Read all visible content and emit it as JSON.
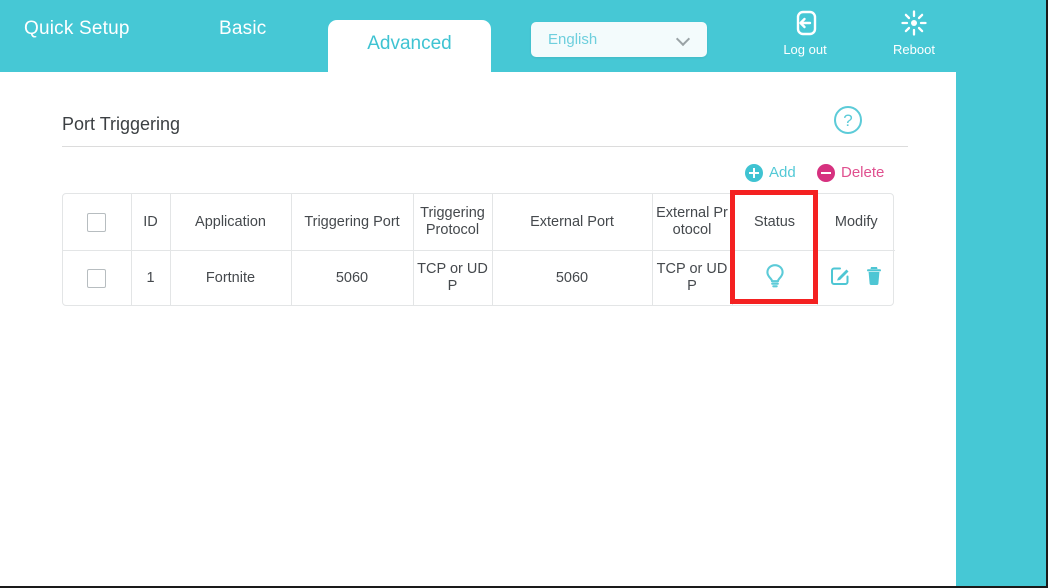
{
  "theme": {
    "teal": "#46c8d5",
    "teal_text": "#3fc3d2",
    "pink": "#d6317f",
    "highlight": "#f42121"
  },
  "header": {
    "tabs": [
      {
        "label": "Quick Setup",
        "active": false
      },
      {
        "label": "Basic",
        "active": false
      },
      {
        "label": "Advanced",
        "active": true
      }
    ],
    "language": {
      "value": "English",
      "icon": "chevron-down-icon"
    },
    "actions": [
      {
        "label": "Log out",
        "icon": "logout-icon"
      },
      {
        "label": "Reboot",
        "icon": "reboot-icon"
      }
    ]
  },
  "page": {
    "title": "Port Triggering",
    "help_icon": "help-circle-icon"
  },
  "toolbar": {
    "add_label": "Add",
    "delete_label": "Delete",
    "add_icon": "plus-circle-icon",
    "delete_icon": "minus-circle-icon"
  },
  "table": {
    "columns": [
      "",
      "ID",
      "Application",
      "Triggering Port",
      "Triggering Protocol",
      "External Port",
      "External Protocol",
      "Status",
      "Modify"
    ],
    "rows": [
      {
        "selected": false,
        "id": "1",
        "application": "Fortnite",
        "triggering_port": "5060",
        "triggering_protocol": "TCP or UDP",
        "external_port": "5060",
        "external_protocol": "TCP or UDP",
        "status_icon": "lightbulb-icon",
        "modify_icons": [
          "edit-icon",
          "delete-icon"
        ]
      }
    ]
  }
}
